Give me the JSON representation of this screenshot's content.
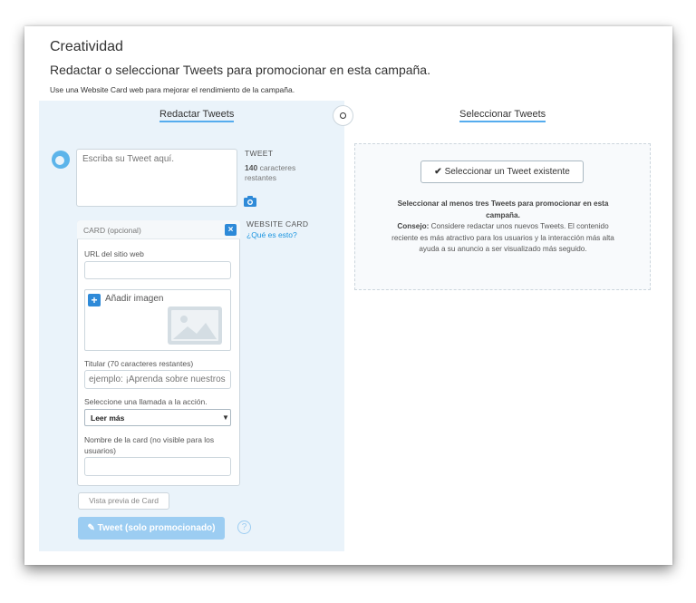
{
  "page": {
    "title": "Creatividad",
    "subtitle": "Redactar o seleccionar Tweets para promocionar en esta campaña.",
    "hint": "Use una Website Card web para mejorar el rendimiento de la campaña."
  },
  "tabs": {
    "compose": "Redactar Tweets",
    "select": "Seleccionar Tweets"
  },
  "compose": {
    "placeholder": "Escriba su Tweet aquí.",
    "tweet_label": "TWEET",
    "char_count": "140",
    "char_suffix": "caracteres restantes",
    "website_card_label": "WEBSITE CARD",
    "website_card_link": "¿Qué es esto?"
  },
  "card": {
    "header": "CARD (opcional)",
    "close": "×",
    "url_label": "URL del sitio web",
    "url_value": "",
    "add_image": "Añadir imagen",
    "headline_label": "Titular (70 caracteres restantes)",
    "headline_placeholder": "ejemplo: ¡Aprenda sobre nuestros productos!",
    "cta_label": "Seleccione una llamada a la acción.",
    "cta_selected": "Leer más",
    "name_label": "Nombre de la card (no visible para los usuarios)",
    "name_value": ""
  },
  "actions": {
    "preview": "Vista previa de Card",
    "tweet": "Tweet (solo promocionado)",
    "help": "?"
  },
  "select_panel": {
    "button": "Seleccionar un Tweet existente",
    "instruction": "Seleccionar al menos tres Tweets para promocionar en esta campaña.",
    "advice_label": "Consejo:",
    "advice_text": "Considere redactar unos nuevos Tweets. El contenido reciente es más atractivo para los usuarios y la interacción más alta ayuda a su anuncio a ser visualizado más seguido."
  },
  "colors": {
    "accent": "#55acee",
    "panel_bg": "#eaf3fa",
    "button_blue": "#2e8ad8",
    "tweet_button": "#9ccdf2"
  }
}
